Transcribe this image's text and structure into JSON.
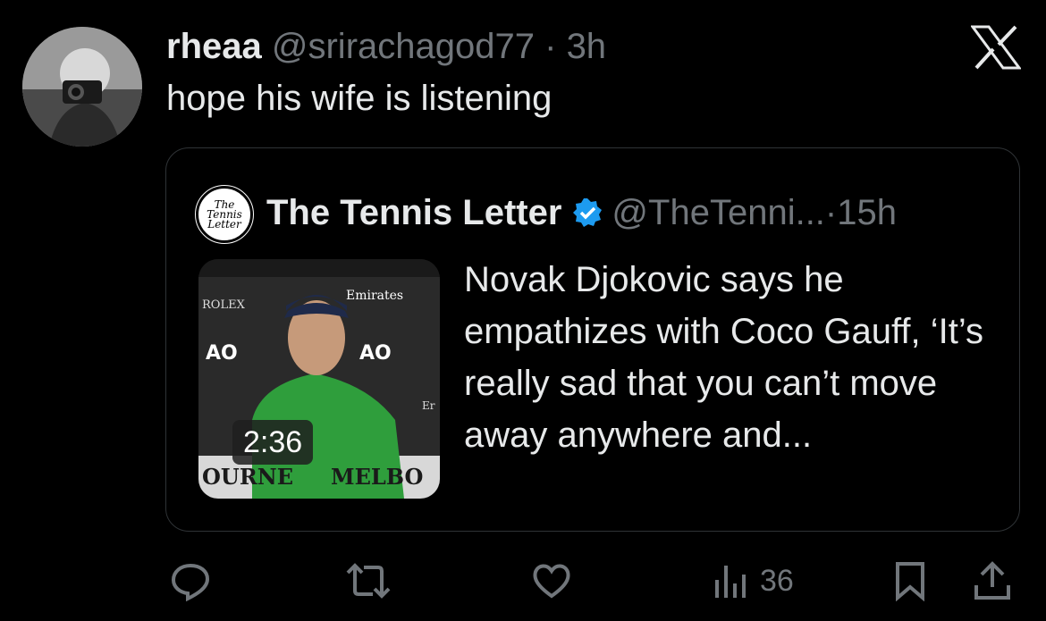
{
  "tweet": {
    "display_name": "rheaa",
    "handle": "@srirachagod77",
    "separator": "·",
    "time": "3h",
    "text": "hope his wife is listening"
  },
  "quoted": {
    "display_name": "The Tennis Letter",
    "avatar_text": "The Tennis Letter",
    "handle": "@TheTenni...",
    "separator": "·",
    "time": "15h",
    "video_duration": "2:36",
    "text": "Novak Djokovic says he empathizes with Coco Gauff, ‘It’s really sad that you can’t move away anywhere and...",
    "thumbnail": {
      "signage": [
        "ROLEX",
        "AO",
        "AO",
        "Emirates",
        "OURNE",
        "MELBO",
        "Er"
      ]
    }
  },
  "actions": {
    "views": "36"
  },
  "colors": {
    "background": "#000000",
    "text": "#e7e9ea",
    "muted": "#71767b",
    "border": "#2f3336",
    "verified": "#1d9bf0",
    "shirt": "#2f9e3c"
  },
  "icons": [
    "x-logo-icon",
    "verified-badge-icon",
    "reply-icon",
    "retweet-icon",
    "like-icon",
    "views-icon",
    "bookmark-icon",
    "share-icon"
  ]
}
